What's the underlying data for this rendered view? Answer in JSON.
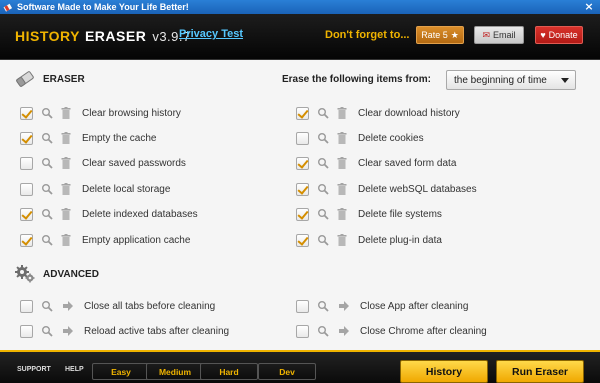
{
  "window": {
    "title": "Software Made to Make Your Life Better!",
    "close_glyph": "×"
  },
  "header": {
    "brand_word1": "HISTORY",
    "brand_word2": "ERASER",
    "version": "v3.9.7",
    "privacy_link": "Privacy Test",
    "dont_forget": "Don't forget to...",
    "rate_label": "Rate 5",
    "email_label": "Email",
    "donate_label": "Donate"
  },
  "eraser": {
    "section_label": "ERASER",
    "erase_from_label": "Erase the following items from:",
    "erase_from_value": "the beginning of time",
    "left_items": [
      {
        "label": "Clear browsing history",
        "checked": true
      },
      {
        "label": "Empty the cache",
        "checked": true
      },
      {
        "label": "Clear saved passwords",
        "checked": false
      },
      {
        "label": "Delete local storage",
        "checked": false
      },
      {
        "label": "Delete indexed databases",
        "checked": true
      },
      {
        "label": "Empty application cache",
        "checked": true
      }
    ],
    "right_items": [
      {
        "label": "Clear download history",
        "checked": true
      },
      {
        "label": "Delete cookies",
        "checked": false
      },
      {
        "label": "Clear saved form data",
        "checked": true
      },
      {
        "label": "Delete webSQL databases",
        "checked": true
      },
      {
        "label": "Delete file systems",
        "checked": true
      },
      {
        "label": "Delete plug-in data",
        "checked": true
      }
    ]
  },
  "advanced": {
    "section_label": "ADVANCED",
    "items": [
      {
        "label": "Close all tabs before cleaning",
        "checked": false
      },
      {
        "label": "Close App after cleaning",
        "checked": false
      },
      {
        "label": "Reload active tabs after cleaning",
        "checked": false
      },
      {
        "label": "Close Chrome after cleaning",
        "checked": false
      }
    ]
  },
  "bottom": {
    "support_label": "SUPPORT",
    "help_label": "HELP",
    "levels": [
      "Easy",
      "Medium",
      "Hard",
      "Dev"
    ],
    "history_button": "History",
    "run_button": "Run Eraser"
  },
  "colors": {
    "accent": "#f0b400",
    "check": "#d48e00",
    "link": "#56c8ff",
    "donate": "#c8231e"
  }
}
